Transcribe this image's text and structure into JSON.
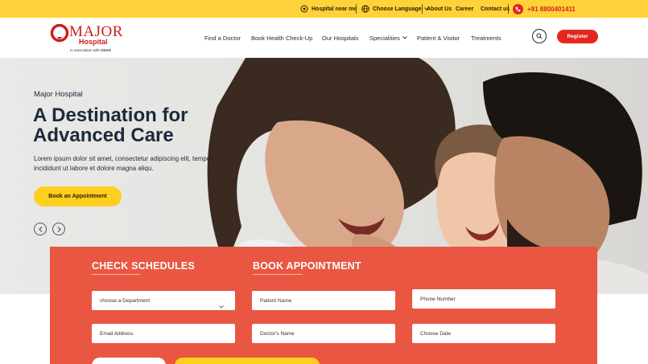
{
  "topbar": {
    "hospital_near_me": "Hospital near me",
    "choose_language": "Choose Language",
    "about_us": "About Us",
    "career": "Career",
    "contact_us": "Contact us",
    "phone": "+91 8800401411"
  },
  "logo": {
    "name": "MAJOR",
    "sub": "Hospital",
    "assoc_prefix": "In association with ",
    "assoc_brand": "CDAS"
  },
  "nav": [
    {
      "label": "Find a Doctor"
    },
    {
      "label": "Book Health Check-Up"
    },
    {
      "label": "Our Hospitals"
    },
    {
      "label": "Specialities"
    },
    {
      "label": "Patient & Visitor"
    },
    {
      "label": "Treatments"
    }
  ],
  "header": {
    "register_label": "Register"
  },
  "hero": {
    "eyebrow": "Major Hospital",
    "title": "A Destination for Advanced Care",
    "text": "Lorem ipsum dolor sit amet, consectetur adipiscing elit, tempor incididunt ut labore et dolore magna aliqu.",
    "cta": "Book an Appointment"
  },
  "booking": {
    "check_schedules": "CHECK SCHEDULES",
    "book_appointment": "BOOK APPOINTMENT",
    "department_placeholder": "choose a Department",
    "email_placeholder": "Email Address",
    "patient_placeholder": "Patient Name",
    "doctor_placeholder": "Doctor's Name",
    "phone_placeholder": "Phone Number",
    "date_placeholder": "Choose Date"
  },
  "colors": {
    "topbar": "#ffd23a",
    "brand_red": "#e5261f",
    "panel": "#e95641",
    "cta_yellow": "#ffcf1f"
  }
}
